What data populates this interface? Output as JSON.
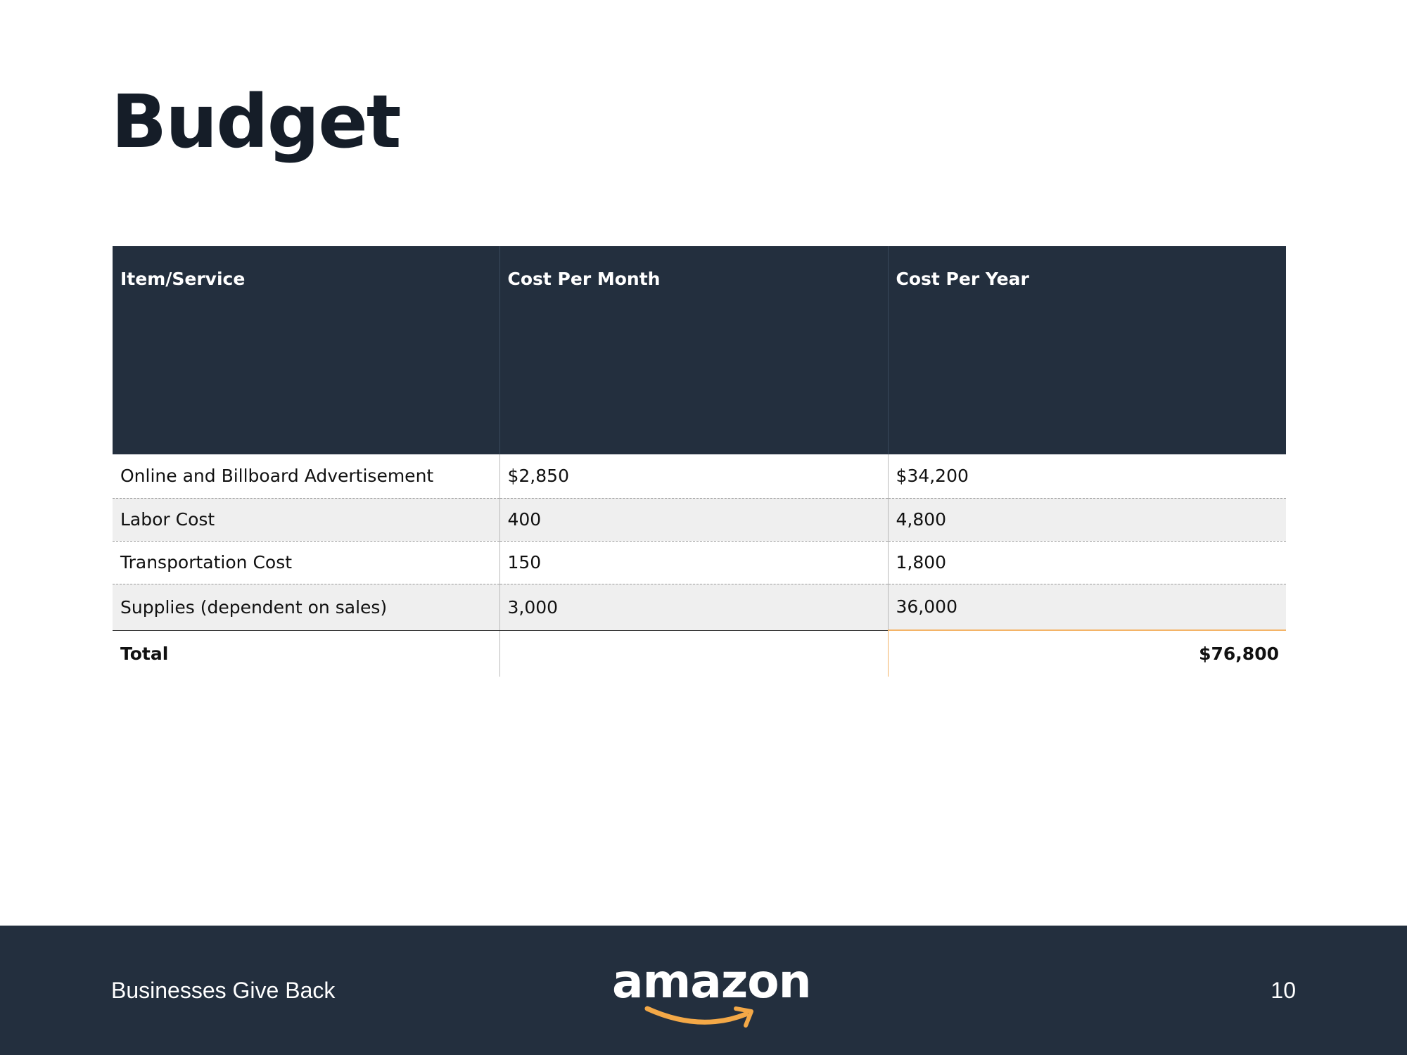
{
  "slide": {
    "title": "Budget"
  },
  "table": {
    "headers": [
      "Item/Service",
      "Cost Per Month",
      "Cost Per Year"
    ],
    "rows": [
      [
        "Online and Billboard Advertisement",
        "$2,850",
        "$34,200"
      ],
      [
        "Labor Cost",
        "400",
        "4,800"
      ],
      [
        "Transportation Cost",
        "150",
        "1,800"
      ],
      [
        "Supplies (dependent on sales)",
        "3,000",
        "36,000"
      ]
    ],
    "total": {
      "label": "Total",
      "per_month": "",
      "per_year": "$76,800"
    }
  },
  "footer": {
    "left_text": "Businesses Give Back",
    "logo": "amazon",
    "page_number": "10"
  },
  "colors": {
    "header_background": "#232f3e",
    "footer_background": "#232f3e",
    "accent": "#f3a847",
    "title_text": "#151d28",
    "alt_row": "#efefef"
  },
  "icons": {
    "logo_smile": "amazon-smile-arrow"
  }
}
